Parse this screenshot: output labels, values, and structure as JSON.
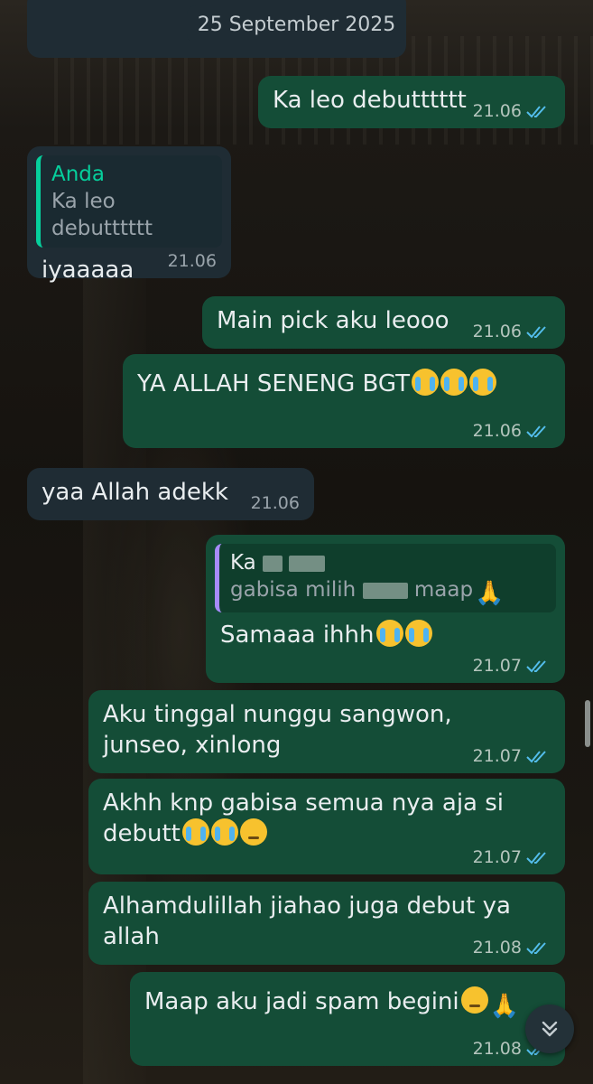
{
  "date_chip": "25 September 2025",
  "messages": [
    {
      "id": "m1",
      "dir": "out",
      "text": "Ka leo debutttttt",
      "time": "21.06"
    },
    {
      "id": "m2",
      "dir": "in",
      "quote_name": "Anda",
      "quote_text": "Ka leo debutttttt",
      "text": "iyaaaaa",
      "time": "21.06"
    },
    {
      "id": "m3",
      "dir": "out",
      "text": "Main pick aku leooo",
      "time": "21.06"
    },
    {
      "id": "m4",
      "dir": "out",
      "text": "YA ALLAH SENENG BGT",
      "time": "21.06"
    },
    {
      "id": "m5",
      "dir": "in",
      "text": "yaa Allah adekk",
      "time": "21.06"
    },
    {
      "id": "m6",
      "dir": "out",
      "quote_name": "Ka",
      "quote_text_pre": "gabisa milih",
      "quote_text_post": "maap",
      "text": "Samaaa ihhh",
      "time": "21.07"
    },
    {
      "id": "m7",
      "dir": "out",
      "text": "Aku tinggal nunggu sangwon,\njunseo, xinlong",
      "time": "21.07"
    },
    {
      "id": "m8",
      "dir": "out",
      "text": "Akhh knp gabisa semua nya aja si\ndebutt",
      "time": "21.07"
    },
    {
      "id": "m9",
      "dir": "out",
      "text": "Alhamdulillah jiahao juga debut ya\nallah",
      "time": "21.08"
    },
    {
      "id": "m10",
      "dir": "out",
      "text": "Maap aku jadi spam begini",
      "time": "21.08"
    }
  ],
  "icons": {
    "read": "double-check-icon",
    "scroll": "chevrons-down-icon"
  },
  "colors": {
    "outgoing": "#144d37",
    "incoming": "#1f2c34",
    "read_ticks": "#53bdeb",
    "quote_accent": "#06cf9c"
  }
}
